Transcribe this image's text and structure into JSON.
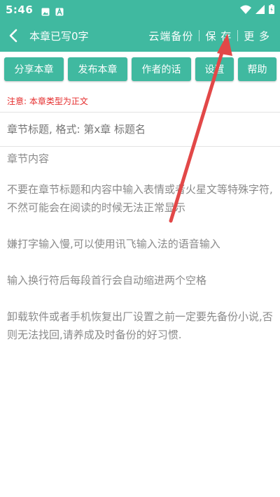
{
  "status_bar": {
    "time": "5:46",
    "icons": [
      "image-icon",
      "a-box-icon",
      "wifi-icon",
      "signal-icon",
      "battery-icon"
    ]
  },
  "app_bar": {
    "title": "本章已写0字",
    "actions": [
      {
        "id": "cloud",
        "label": "云端备份"
      },
      {
        "id": "save",
        "label": "保 存"
      },
      {
        "id": "more",
        "label": "更 多"
      }
    ]
  },
  "toolbar": {
    "buttons": [
      "分享本章",
      "发布本章",
      "作者的话",
      "设置",
      "帮助"
    ]
  },
  "notice": "注意: 本章类型为正文",
  "chapter_title": {
    "placeholder": "章节标题, 格式: 第x章 标题名",
    "value": ""
  },
  "content": {
    "placeholder_label": "章节内容",
    "tips": [
      "不要在章节标题和内容中输入表情或者火星文等特殊字符,不然可能会在阅读的时候无法正常显示",
      "嫌打字输入慢,可以使用讯飞输入法的语音输入",
      "输入换行符后每段首行会自动缩进两个空格",
      "卸载软件或者手机恢复出厂设置之前一定要先备份小说,否则无法找回,请养成及时备份的好习惯."
    ]
  },
  "colors": {
    "accent": "#40b9a0",
    "notice": "#e52c2c",
    "hint_text": "#8a8a8a",
    "annotation_arrow": "#e24848"
  }
}
